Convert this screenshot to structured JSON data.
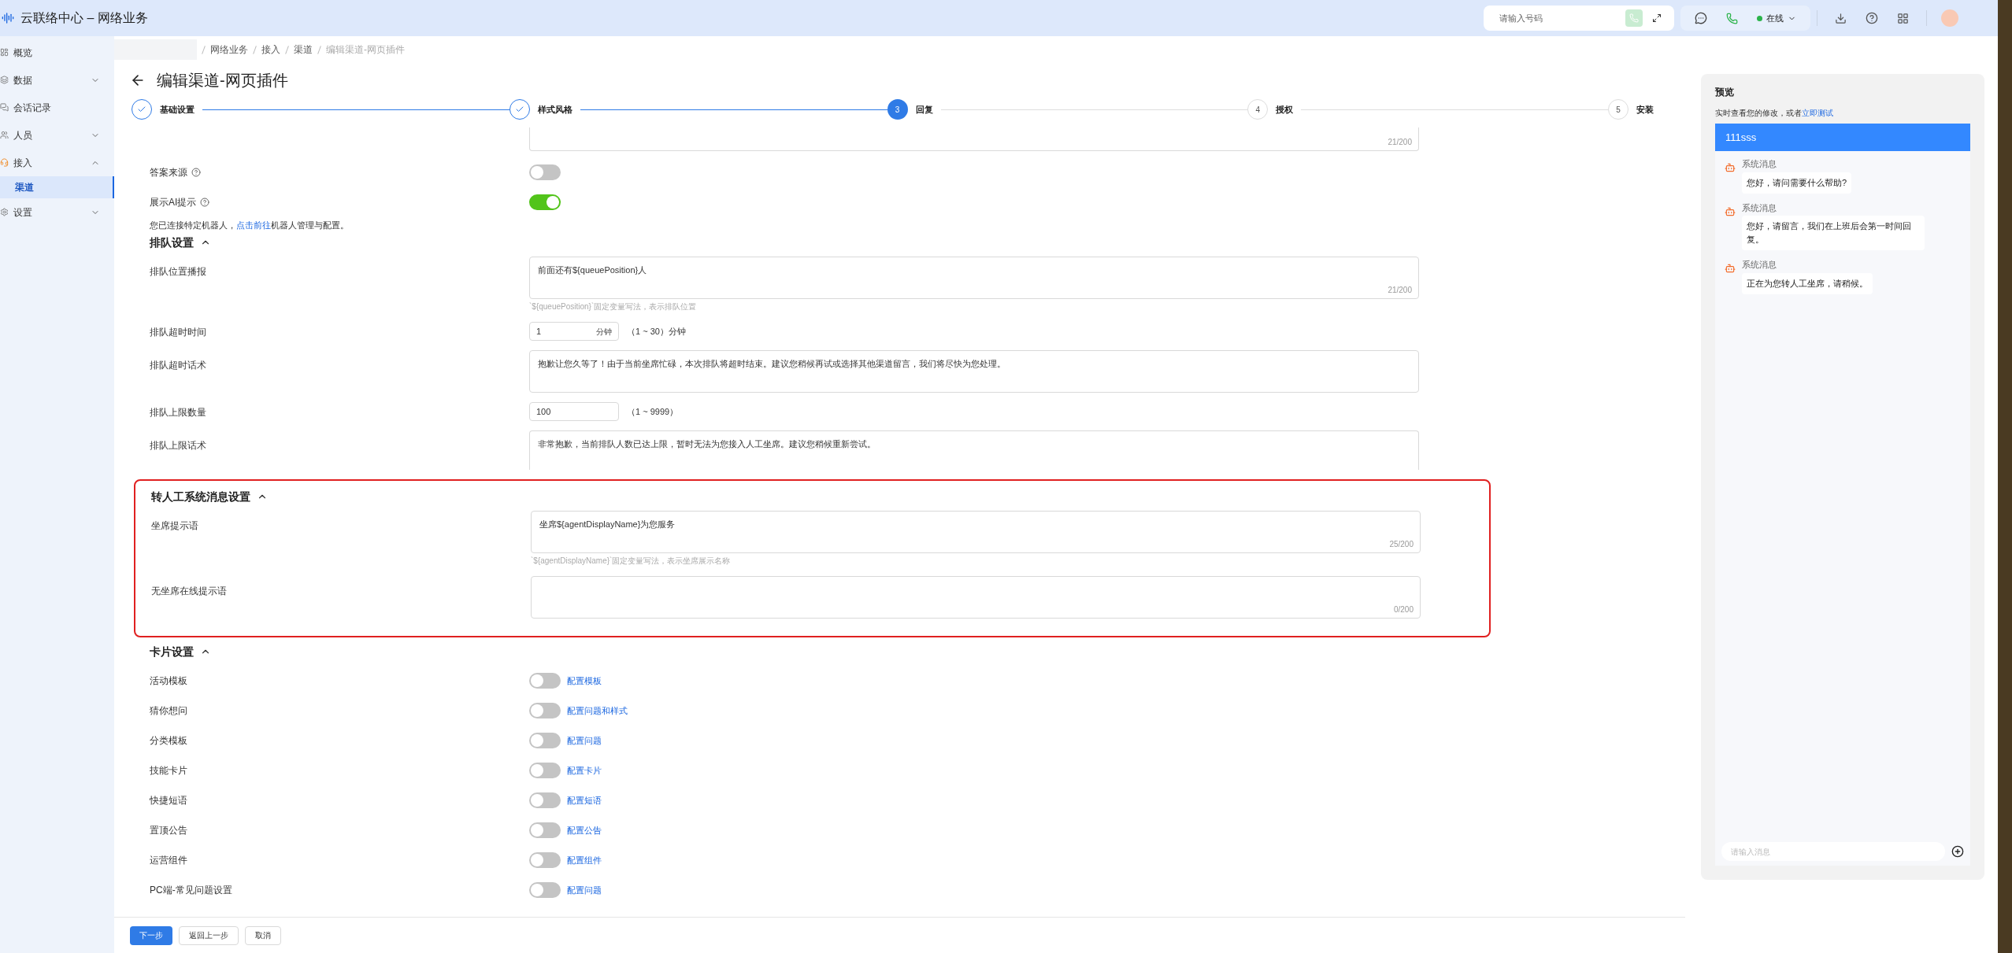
{
  "app": {
    "title": "云联络中心 – 网络业务"
  },
  "topbar": {
    "dial_placeholder": "请输入号码",
    "status": "在线",
    "online": true
  },
  "sidebar": {
    "items": [
      {
        "label": "概览",
        "selected": false
      },
      {
        "label": "数据",
        "expanded": false,
        "selected": false
      },
      {
        "label": "会话记录",
        "selected": false
      },
      {
        "label": "人员",
        "expanded": false,
        "selected": false
      },
      {
        "label": "接入",
        "expanded": true,
        "selected": false,
        "children": [
          {
            "label": "渠道",
            "selected": true
          }
        ]
      },
      {
        "label": "设置",
        "expanded": false,
        "selected": false
      }
    ]
  },
  "breadcrumb": [
    "网络业务",
    "接入",
    "渠道",
    "编辑渠道-网页插件"
  ],
  "page_title": "编辑渠道-网页插件",
  "steps": [
    {
      "label": "基础设置",
      "completed": true,
      "selected": false
    },
    {
      "label": "样式风格",
      "completed": true,
      "selected": false
    },
    {
      "number": "3",
      "label": "回复",
      "completed": false,
      "selected": true
    },
    {
      "number": "4",
      "label": "授权",
      "completed": false,
      "selected": false
    },
    {
      "number": "5",
      "label": "安装",
      "completed": false,
      "selected": false
    }
  ],
  "form": {
    "rows": [
      {
        "kind": "textarea_tail",
        "counter": "21/200"
      },
      {
        "kind": "toggle",
        "label": "答案来源",
        "help": true,
        "on": false
      },
      {
        "kind": "toggle",
        "label": "展示AI提示",
        "help": true,
        "on": true
      },
      {
        "kind": "note",
        "text": "您已连接特定机器人，",
        "link": "点击前往",
        "after": "机器人管理与配置。"
      },
      {
        "kind": "section",
        "title": "排队设置",
        "expanded": true
      },
      {
        "kind": "textarea",
        "label": "排队位置播报",
        "value": "前面还有${queuePosition}人",
        "counter": "21/200",
        "hint": "`${queuePosition}`固定变量写法，表示排队位置"
      },
      {
        "kind": "number",
        "label": "排队超时时间",
        "value": "1",
        "unit": "分钟",
        "range": "（1 ~ 30）分钟"
      },
      {
        "kind": "textarea",
        "label": "排队超时话术",
        "value": "抱歉让您久等了！由于当前坐席忙碌，本次排队将超时结束。建议您稍候再试或选择其他渠道留言，我们将尽快为您处理。"
      },
      {
        "kind": "number",
        "label": "排队上限数量",
        "value": "100",
        "range": "（1 ~ 9999）"
      },
      {
        "kind": "textarea",
        "label": "排队上限话术",
        "value": "非常抱歉，当前排队人数已达上限，暂时无法为您接入人工坐席。建议您稍候重新尝试。",
        "cut": true
      },
      {
        "kind": "group",
        "highlighted": true,
        "section": {
          "title": "转人工系统消息设置",
          "expanded": true
        },
        "rows": [
          {
            "kind": "textarea",
            "label": "坐席提示语",
            "value": "坐席${agentDisplayName}为您服务",
            "counter": "25/200",
            "hint": "`${agentDisplayName}`固定变量写法，表示坐席展示名称"
          },
          {
            "kind": "textarea",
            "label": "无坐席在线提示语",
            "counter": "0/200"
          }
        ]
      },
      {
        "kind": "section",
        "title": "卡片设置",
        "expanded": true
      },
      {
        "kind": "toggle",
        "label": "活动模板",
        "on": false,
        "link": "配置模板"
      },
      {
        "kind": "toggle",
        "label": "猜你想问",
        "on": false,
        "link": "配置问题和样式"
      },
      {
        "kind": "toggle",
        "label": "分类模板",
        "on": false,
        "link": "配置问题"
      },
      {
        "kind": "toggle",
        "label": "技能卡片",
        "on": false,
        "link": "配置卡片"
      },
      {
        "kind": "toggle",
        "label": "快捷短语",
        "on": false,
        "link": "配置短语"
      },
      {
        "kind": "toggle",
        "label": "置顶公告",
        "on": false,
        "link": "配置公告"
      },
      {
        "kind": "toggle",
        "label": "运营组件",
        "on": false,
        "link": "配置组件"
      },
      {
        "kind": "toggle",
        "label": "PC端-常见问题设置",
        "on": false,
        "link": "配置问题"
      }
    ]
  },
  "footer": {
    "buttons": [
      {
        "label": "下一步",
        "kind": "primary"
      },
      {
        "label": "返回上一步",
        "kind": "default"
      },
      {
        "label": "取消",
        "kind": "default"
      }
    ]
  },
  "preview": {
    "title": "预览",
    "subtitle": "实时查看您的修改，或者",
    "link": "立即测试",
    "chat_title": "111sss",
    "messages": [
      {
        "sender": "系统消息",
        "text": "您好，请问需要什么帮助?"
      },
      {
        "sender": "系统消息",
        "text": "您好，请留言，我们在上班后会第一时间回复。"
      },
      {
        "sender": "系统消息",
        "text": "正在为您转人工坐席，请稍候。"
      }
    ],
    "input_placeholder": "请输入消息"
  }
}
